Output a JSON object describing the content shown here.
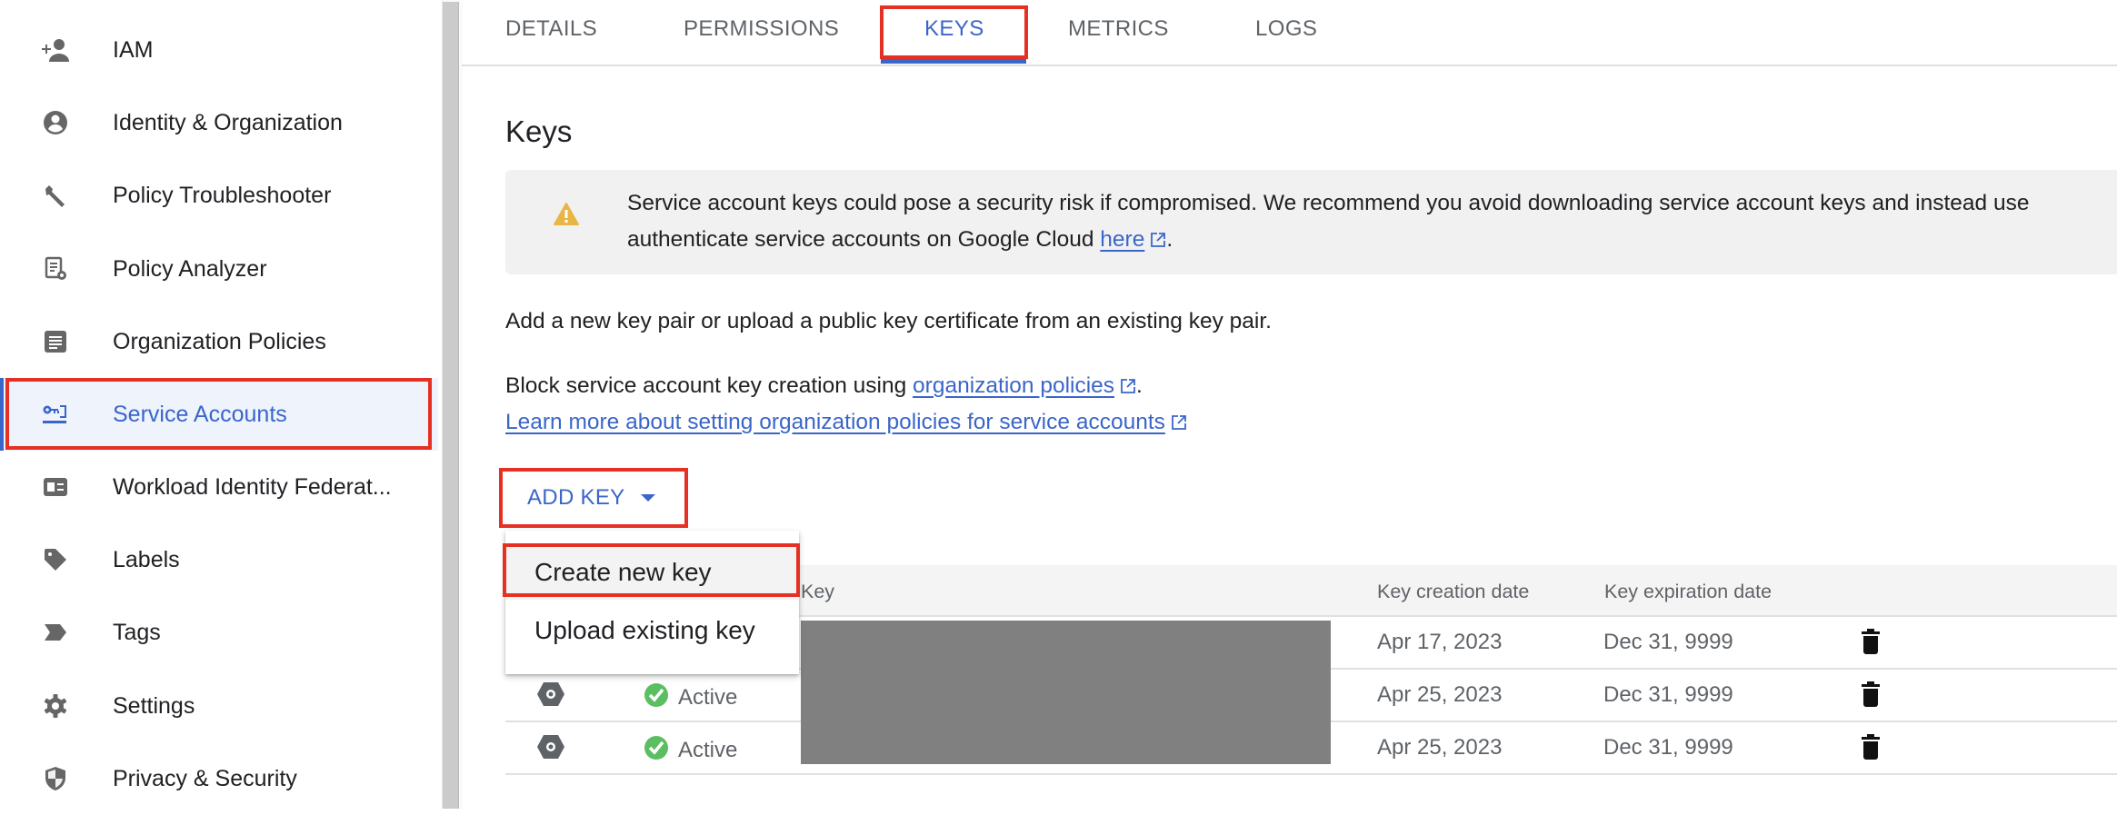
{
  "sidebar": {
    "items": [
      {
        "label": "IAM",
        "icon": "person-add-icon"
      },
      {
        "label": "Identity & Organization",
        "icon": "account-circle-icon"
      },
      {
        "label": "Policy Troubleshooter",
        "icon": "wrench-icon"
      },
      {
        "label": "Policy Analyzer",
        "icon": "document-search-icon"
      },
      {
        "label": "Organization Policies",
        "icon": "list-box-icon"
      },
      {
        "label": "Service Accounts",
        "icon": "service-account-key-icon",
        "active": true
      },
      {
        "label": "Workload Identity Federat...",
        "icon": "id-card-icon"
      },
      {
        "label": "Labels",
        "icon": "tag-icon"
      },
      {
        "label": "Tags",
        "icon": "label-arrow-icon"
      },
      {
        "label": "Settings",
        "icon": "gear-icon"
      },
      {
        "label": "Privacy & Security",
        "icon": "shield-icon"
      }
    ]
  },
  "tabs": [
    {
      "label": "DETAILS"
    },
    {
      "label": "PERMISSIONS"
    },
    {
      "label": "KEYS",
      "active": true
    },
    {
      "label": "METRICS"
    },
    {
      "label": "LOGS"
    }
  ],
  "page": {
    "title": "Keys",
    "banner": {
      "icon": "warning-icon",
      "line1": "Service account keys could pose a security risk if compromised. We recommend you avoid downloading service account keys and instead use",
      "line2_prefix": "authenticate service accounts on Google Cloud ",
      "line2_link": "here",
      "line2_suffix": "."
    },
    "intro": "Add a new key pair or upload a public key certificate from an existing key pair.",
    "block_prefix": "Block service account key creation using ",
    "block_link": "organization policies",
    "block_suffix": ".",
    "learn_more_link": "Learn more about setting organization policies for service accounts"
  },
  "add_key": {
    "label": "ADD KEY",
    "menu": [
      {
        "label": "Create new key"
      },
      {
        "label": "Upload existing key"
      }
    ]
  },
  "table": {
    "columns": [
      "Key",
      "Key creation date",
      "Key expiration date"
    ],
    "rows": [
      {
        "status": "",
        "created": "Apr 17, 2023",
        "expires": "Dec 31, 9999"
      },
      {
        "status": "Active",
        "created": "Apr 25, 2023",
        "expires": "Dec 31, 9999"
      },
      {
        "status": "Active",
        "created": "Apr 25, 2023",
        "expires": "Dec 31, 9999"
      }
    ]
  },
  "colors": {
    "accent": "#3b66c9",
    "highlight_box": "#e53123",
    "active_status": "#5bbf62",
    "warning": "#e9b545"
  }
}
